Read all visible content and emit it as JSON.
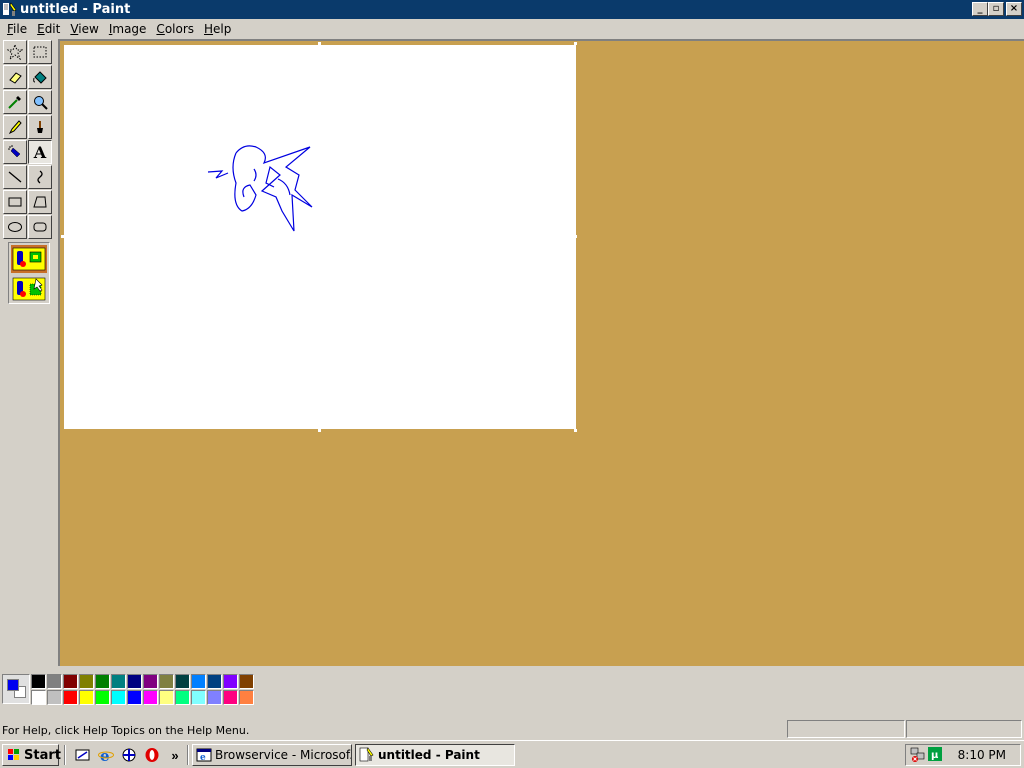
{
  "window": {
    "title": "untitled - Paint",
    "controls": {
      "minimize": "_",
      "maximize": "▫",
      "close": "×"
    }
  },
  "menu": {
    "items": [
      {
        "label": "File"
      },
      {
        "label": "Edit"
      },
      {
        "label": "View"
      },
      {
        "label": "Image"
      },
      {
        "label": "Colors"
      },
      {
        "label": "Help"
      }
    ]
  },
  "toolbox": {
    "tools": [
      {
        "name": "free-form-select",
        "icon": "star-select-icon"
      },
      {
        "name": "select",
        "icon": "rect-select-icon"
      },
      {
        "name": "eraser",
        "icon": "eraser-icon"
      },
      {
        "name": "fill",
        "icon": "paint-bucket-icon"
      },
      {
        "name": "pick-color",
        "icon": "eyedropper-icon"
      },
      {
        "name": "magnifier",
        "icon": "magnifier-icon"
      },
      {
        "name": "pencil",
        "icon": "pencil-icon"
      },
      {
        "name": "brush",
        "icon": "brush-icon"
      },
      {
        "name": "airbrush",
        "icon": "airbrush-icon"
      },
      {
        "name": "text",
        "icon": "text-icon",
        "glyph": "A"
      },
      {
        "name": "line",
        "icon": "line-icon"
      },
      {
        "name": "curve",
        "icon": "curve-icon"
      },
      {
        "name": "rectangle",
        "icon": "rectangle-icon"
      },
      {
        "name": "polygon",
        "icon": "polygon-icon"
      },
      {
        "name": "ellipse",
        "icon": "ellipse-icon"
      },
      {
        "name": "rounded-rectangle",
        "icon": "rounded-rectangle-icon"
      }
    ],
    "selected_tool": "text",
    "options": [
      {
        "name": "opaque-background",
        "selected": true
      },
      {
        "name": "transparent-background",
        "selected": false
      }
    ]
  },
  "colors": {
    "foreground": "#0000f0",
    "background": "#ffffff",
    "workspace": "#c8a050",
    "title_bar": "#0a3a6b",
    "palette_row1": [
      "#000000",
      "#808080",
      "#800000",
      "#808000",
      "#008000",
      "#008080",
      "#000080",
      "#800080",
      "#808040",
      "#004040",
      "#0080ff",
      "#004080",
      "#8000ff",
      "#804000"
    ],
    "palette_row2": [
      "#ffffff",
      "#c0c0c0",
      "#ff0000",
      "#ffff00",
      "#00ff00",
      "#00ffff",
      "#0000ff",
      "#ff00ff",
      "#ffff80",
      "#00ff80",
      "#80ffff",
      "#8080ff",
      "#ff0080",
      "#ff8040"
    ]
  },
  "status": {
    "text": "For Help, click Help Topics on the Help Menu."
  },
  "taskbar": {
    "start_label": "Start",
    "quick_launch": [
      "show-desktop-icon",
      "internet-explorer-icon",
      "channels-icon",
      "opera-icon"
    ],
    "overflow": "»",
    "tasks": [
      {
        "label": "Browservice - Microsof...",
        "icon": "ie-window-icon",
        "active": false
      },
      {
        "label": "untitled - Paint",
        "icon": "paint-icon",
        "active": true
      }
    ],
    "tray_icons": [
      "network-icon",
      "utorrent-icon"
    ],
    "clock": "8:10 PM"
  }
}
